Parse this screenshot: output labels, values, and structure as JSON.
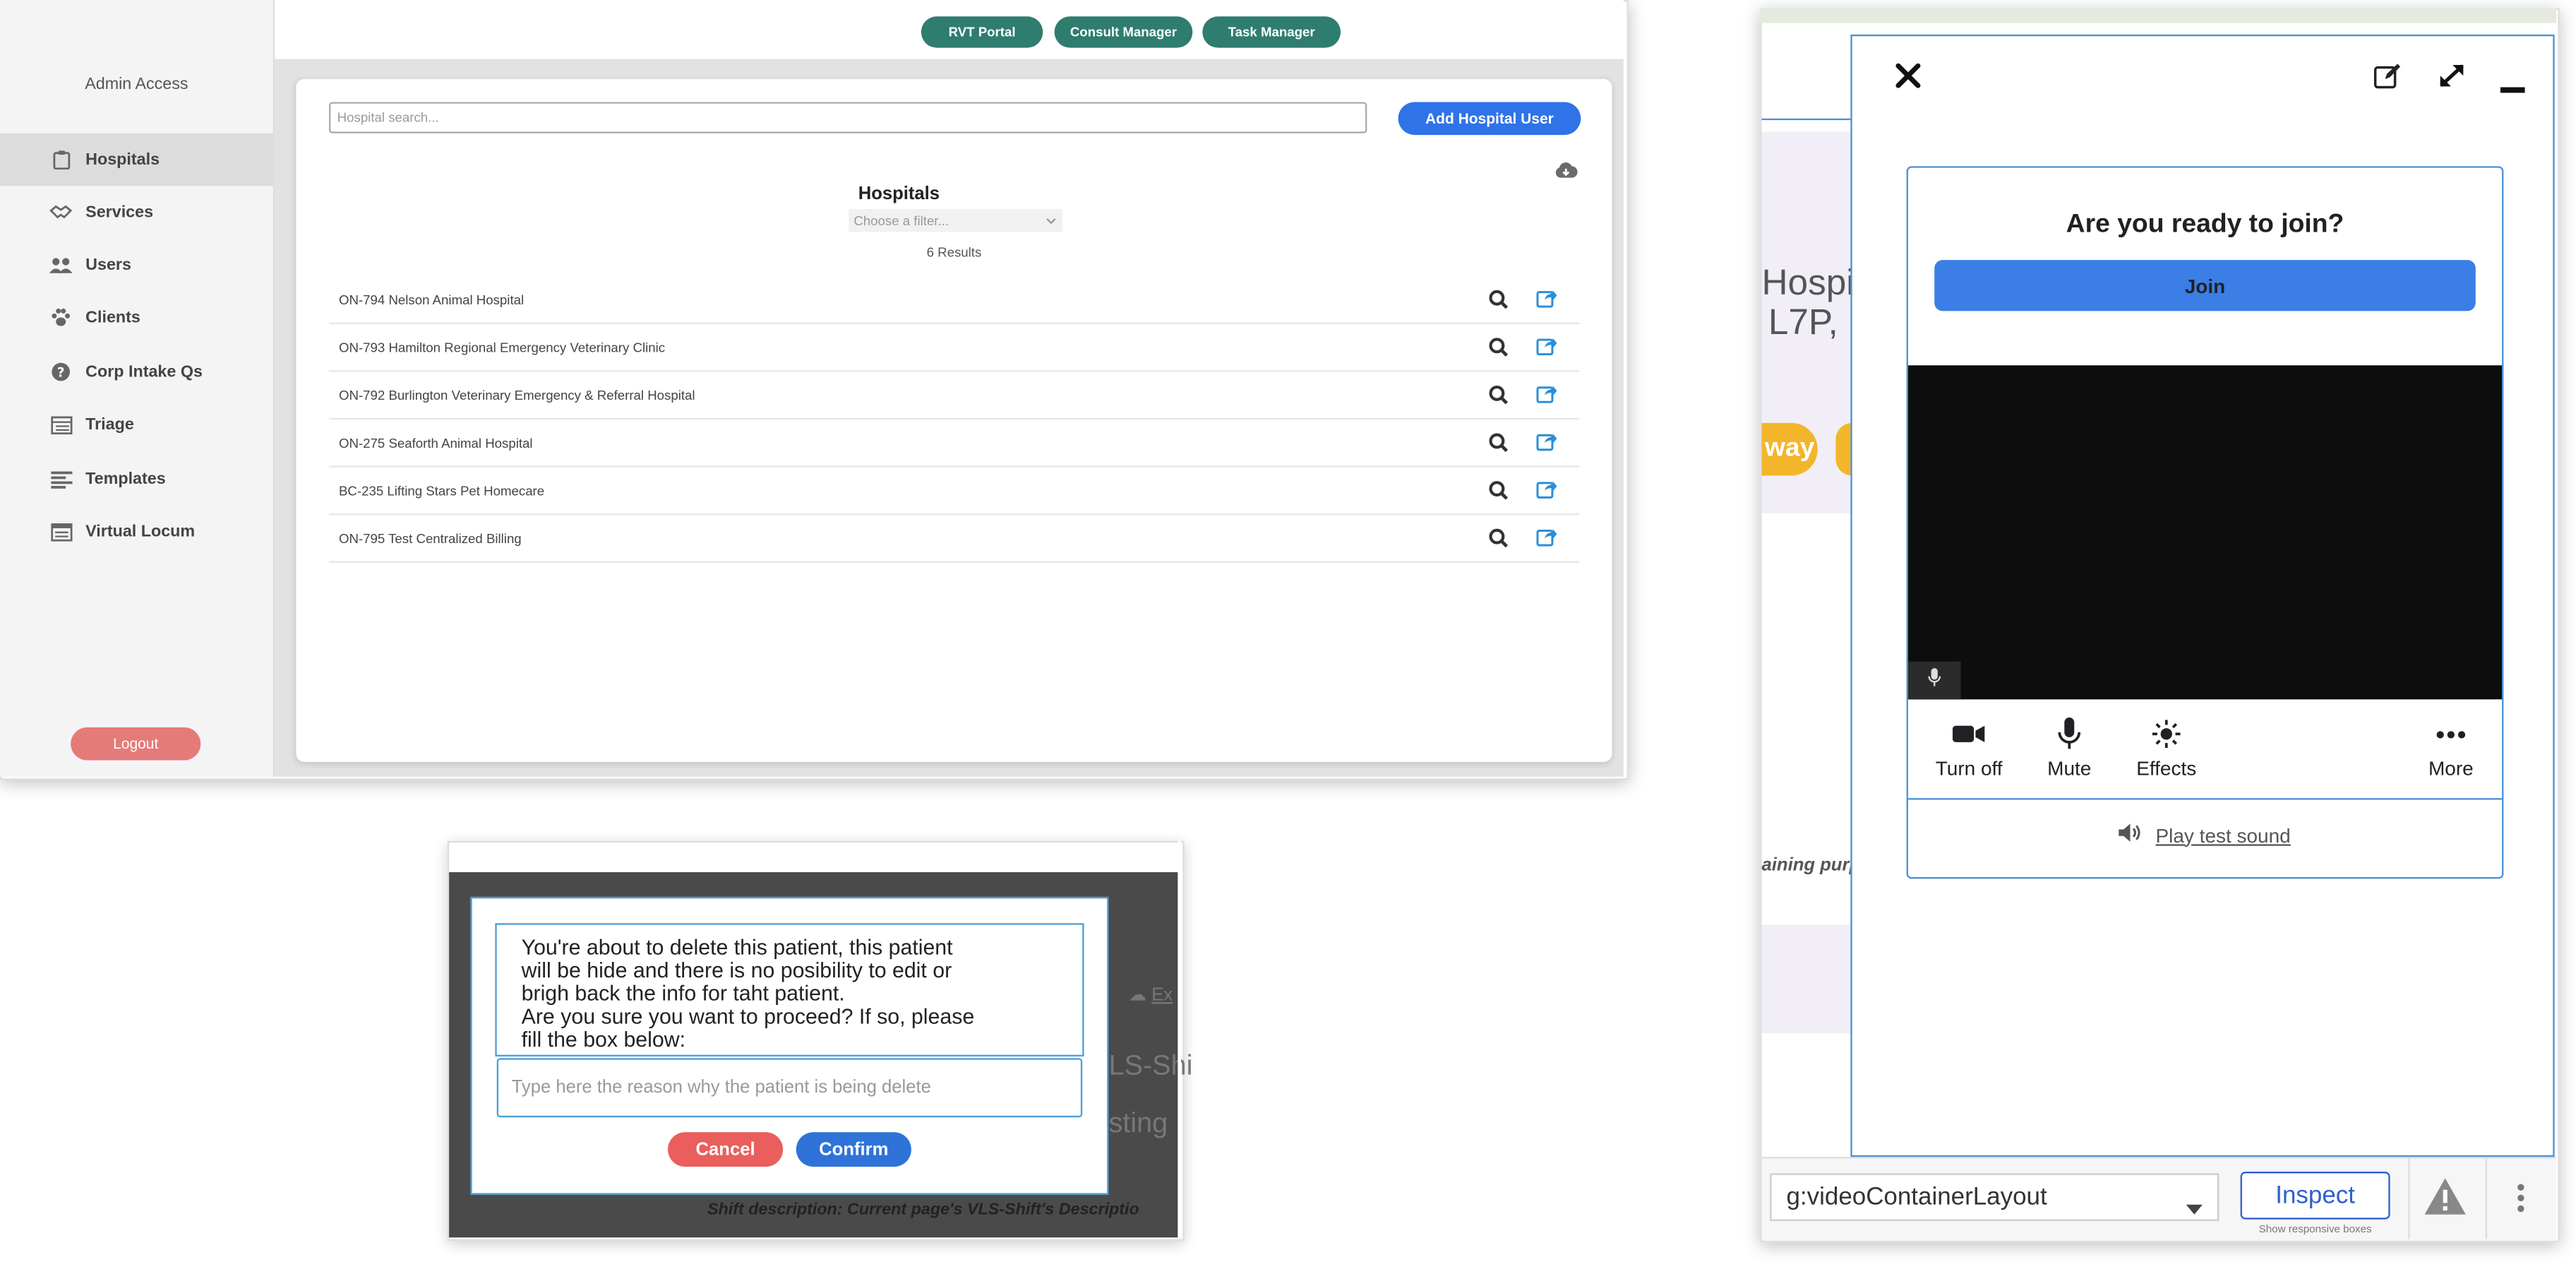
{
  "admin": {
    "sidebar": {
      "access_title": "Admin Access",
      "items": [
        {
          "label": "Hospitals",
          "icon": "clipboard-icon",
          "active": true
        },
        {
          "label": "Services",
          "icon": "handshake-icon"
        },
        {
          "label": "Users",
          "icon": "users-icon"
        },
        {
          "label": "Clients",
          "icon": "paw-icon"
        },
        {
          "label": "Corp Intake Qs",
          "icon": "question-circle-icon"
        },
        {
          "label": "Triage",
          "icon": "list-table-icon"
        },
        {
          "label": "Templates",
          "icon": "align-left-icon"
        },
        {
          "label": "Virtual Locum",
          "icon": "calendar-table-icon"
        }
      ],
      "logout_label": "Logout"
    },
    "topnav": {
      "rvt_label": "RVT Portal",
      "consult_label": "Consult Manager",
      "task_label": "Task Manager"
    },
    "search_placeholder": "Hospital search...",
    "add_user_label": "Add Hospital User",
    "download_icon": "cloud-download-icon",
    "list_title": "Hospitals",
    "filter_placeholder": "Choose a filter...",
    "results_text": "6 Results",
    "hospitals": [
      "ON-794 Nelson Animal Hospital",
      "ON-793 Hamilton Regional Emergency Veterinary Clinic",
      "ON-792 Burlington Veterinary Emergency & Referral Hospital",
      "ON-275 Seaforth Animal Hospital",
      "BC-235 Lifting Stars Pet Homecare",
      "ON-795 Test Centralized Billing"
    ],
    "colors": {
      "pill": "#2e7d6e",
      "add_button": "#2f73e8",
      "logout": "#e57b78"
    }
  },
  "dialog": {
    "message_lines": [
      "You're about to delete this patient, this patient",
      "will be hide and there is no posibility to edit or",
      "brigh back the info for taht patient.",
      "Are you sure you want to proceed? If so, please",
      "fill the box below:"
    ],
    "reason_placeholder": "Type here the reason why the patient is being delete",
    "cancel_label": "Cancel",
    "confirm_label": "Confirm",
    "bg_export_text": "Ex",
    "bg_text1": "LS-Shi",
    "bg_text2": "sting I",
    "shift_description": "Shift description: Current page's VLS-Shift's Descriptio"
  },
  "video": {
    "bg_text_line1": "Hospit",
    "bg_text_line2": "L7P,",
    "bg_badge_text": "way",
    "bg_italic_text": "aining purp",
    "ready_text": "Are you ready to join?",
    "join_label": "Join",
    "controls": [
      {
        "label": "Turn off",
        "icon": "video-camera-icon"
      },
      {
        "label": "Mute",
        "icon": "microphone-icon"
      },
      {
        "label": "Effects",
        "icon": "sparkle-icon"
      },
      {
        "label": "More",
        "icon": "more-horizontal-icon"
      }
    ],
    "test_sound_label": "Play test sound",
    "layout_select_value": "g:videoContainerLayout",
    "inspect_label": "Inspect",
    "responsive_text": "Show responsive boxes"
  }
}
